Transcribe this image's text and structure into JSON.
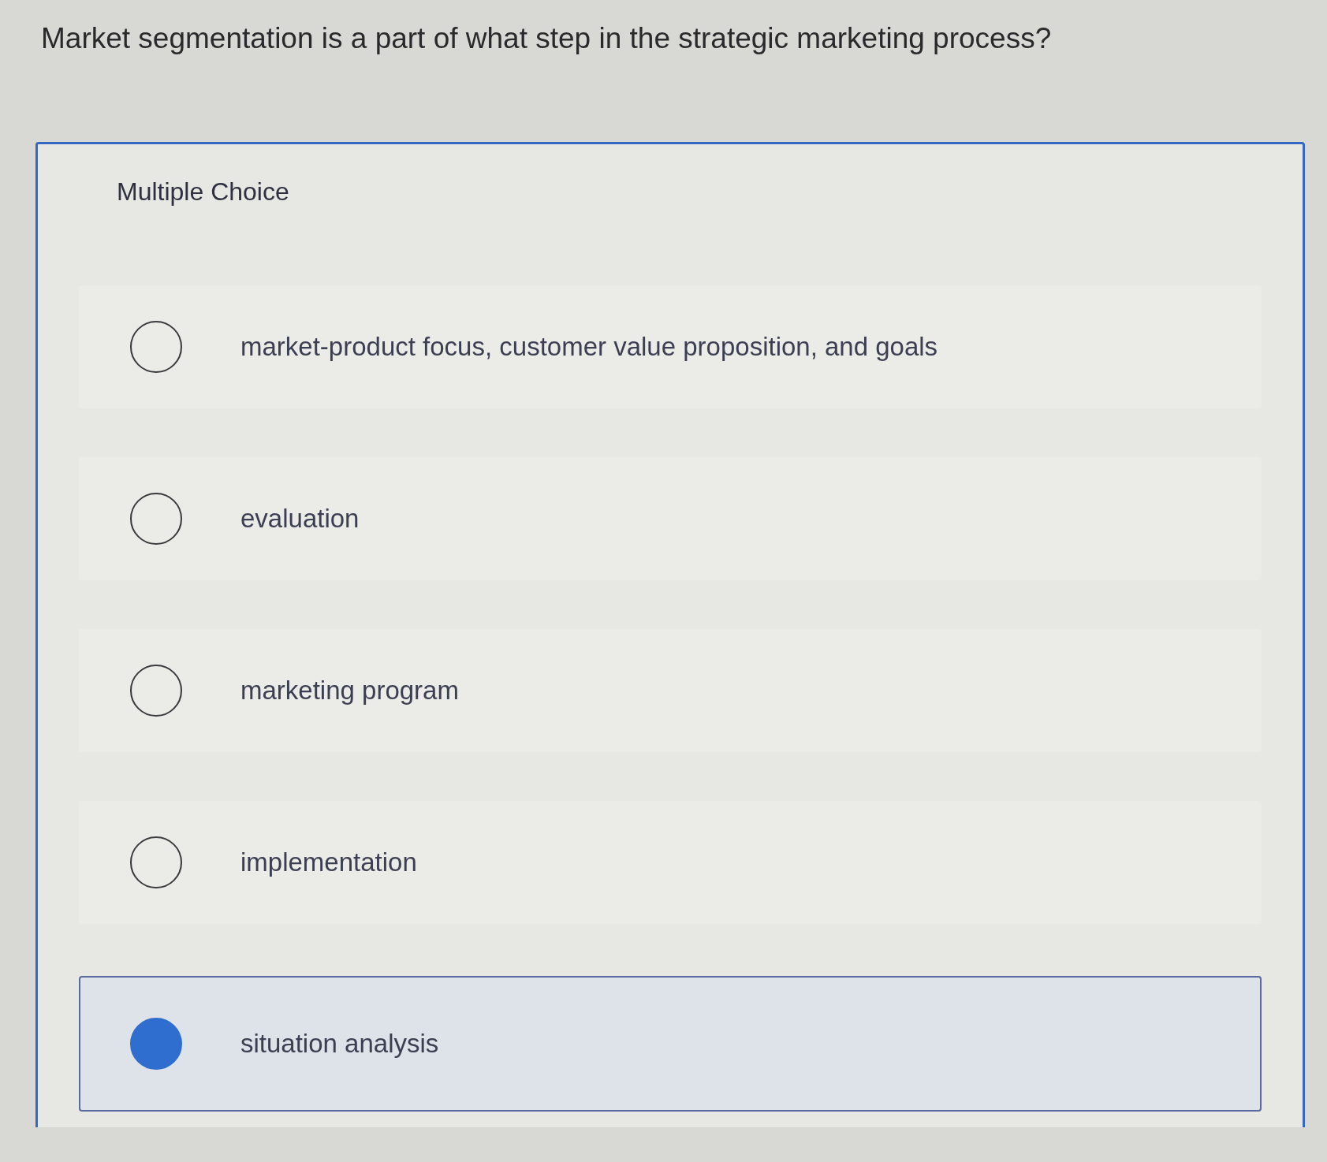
{
  "question": "Market segmentation is a part of what step in the strategic marketing process?",
  "card": {
    "label": "Multiple Choice"
  },
  "options": [
    {
      "label": "market-product focus, customer value proposition, and goals",
      "selected": false
    },
    {
      "label": "evaluation",
      "selected": false
    },
    {
      "label": "marketing program",
      "selected": false
    },
    {
      "label": "implementation",
      "selected": false
    },
    {
      "label": "situation analysis",
      "selected": true
    }
  ]
}
